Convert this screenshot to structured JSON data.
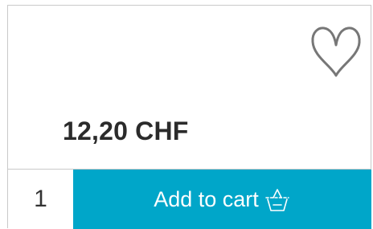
{
  "product": {
    "price": "12,20 CHF",
    "favorite_icon": "heart-outline-icon"
  },
  "cart": {
    "quantity": "1",
    "add_label": "Add to cart",
    "basket_icon": "basket-icon"
  },
  "colors": {
    "accent": "#00a6c9",
    "price_text": "#2b2b2b",
    "border": "#c9c9c9",
    "heart_stroke": "#777777"
  }
}
